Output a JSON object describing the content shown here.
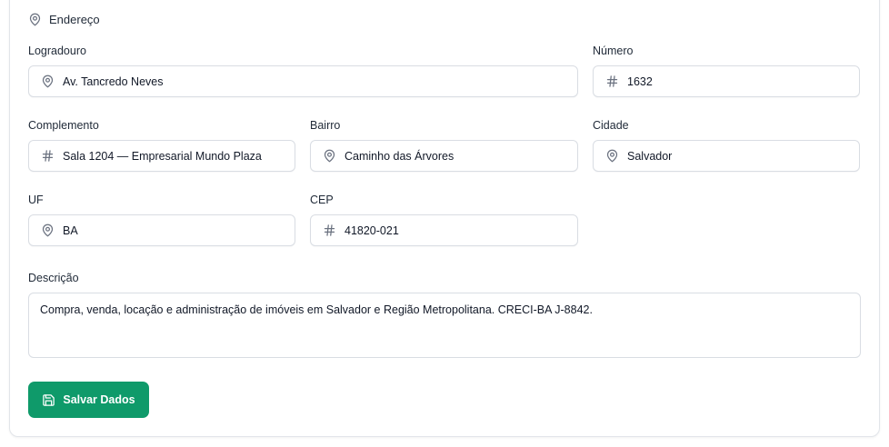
{
  "section": {
    "title": "Endereço",
    "icon": "map-pin-icon"
  },
  "fields": {
    "logradouro": {
      "label": "Logradouro",
      "value": "Av. Tancredo Neves",
      "icon": "map-pin-icon"
    },
    "numero": {
      "label": "Número",
      "value": "1632",
      "icon": "hash-icon"
    },
    "complemento": {
      "label": "Complemento",
      "value": "Sala 1204 — Empresarial Mundo Plaza",
      "icon": "hash-icon"
    },
    "bairro": {
      "label": "Bairro",
      "value": "Caminho das Árvores",
      "icon": "map-pin-icon"
    },
    "cidade": {
      "label": "Cidade",
      "value": "Salvador",
      "icon": "map-pin-icon"
    },
    "uf": {
      "label": "UF",
      "value": "BA",
      "icon": "map-pin-icon"
    },
    "cep": {
      "label": "CEP",
      "value": "41820-021",
      "icon": "hash-icon"
    }
  },
  "descricao": {
    "label": "Descrição",
    "value": "Compra, venda, locação e administração de imóveis em Salvador e Região Metropolitana. CRECI-BA J-8842."
  },
  "actions": {
    "save_label": "Salvar Dados",
    "save_icon": "save-icon"
  },
  "colors": {
    "primary": "#0f9a6a",
    "border": "#d9dde3",
    "icon": "#6b7280"
  }
}
